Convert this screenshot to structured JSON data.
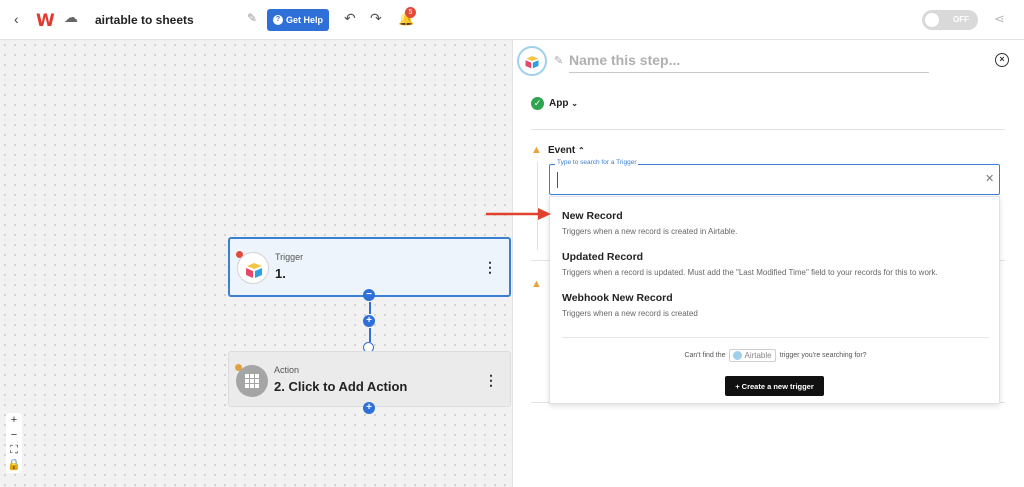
{
  "header": {
    "title": "airtable to sheets",
    "help_label": "Get Help",
    "notification_count": "5",
    "toggle_label": "OFF"
  },
  "canvas": {
    "trigger": {
      "label": "Trigger",
      "title": "1."
    },
    "action": {
      "label": "Action",
      "title": "2. Click to Add Action"
    },
    "zoom": {
      "in": "+",
      "out": "−"
    }
  },
  "panel": {
    "step_name_placeholder": "Name this step...",
    "app_label": "App",
    "event_label": "Event",
    "search": {
      "legend": "Type to search for a Trigger",
      "value": ""
    },
    "options": [
      {
        "title": "New Record",
        "desc": "Triggers when a new record is created in Airtable."
      },
      {
        "title": "Updated Record",
        "desc": "Triggers when a record is updated. Must add the \"Last Modified Time\" field to your records for this to work."
      },
      {
        "title": "Webhook New Record",
        "desc": "Triggers when a new record is created"
      }
    ],
    "cant_find_prefix": "Can't find the",
    "app_chip": "Airtable",
    "cant_find_suffix": "trigger you're searching for?",
    "create_label": "+ Create a new trigger"
  },
  "colors": {
    "accent": "#2f6fd8",
    "brand": "#e03a2f",
    "warning": "#e8a33d",
    "success": "#2ea44f",
    "annotation_arrow": "#e0422f"
  }
}
